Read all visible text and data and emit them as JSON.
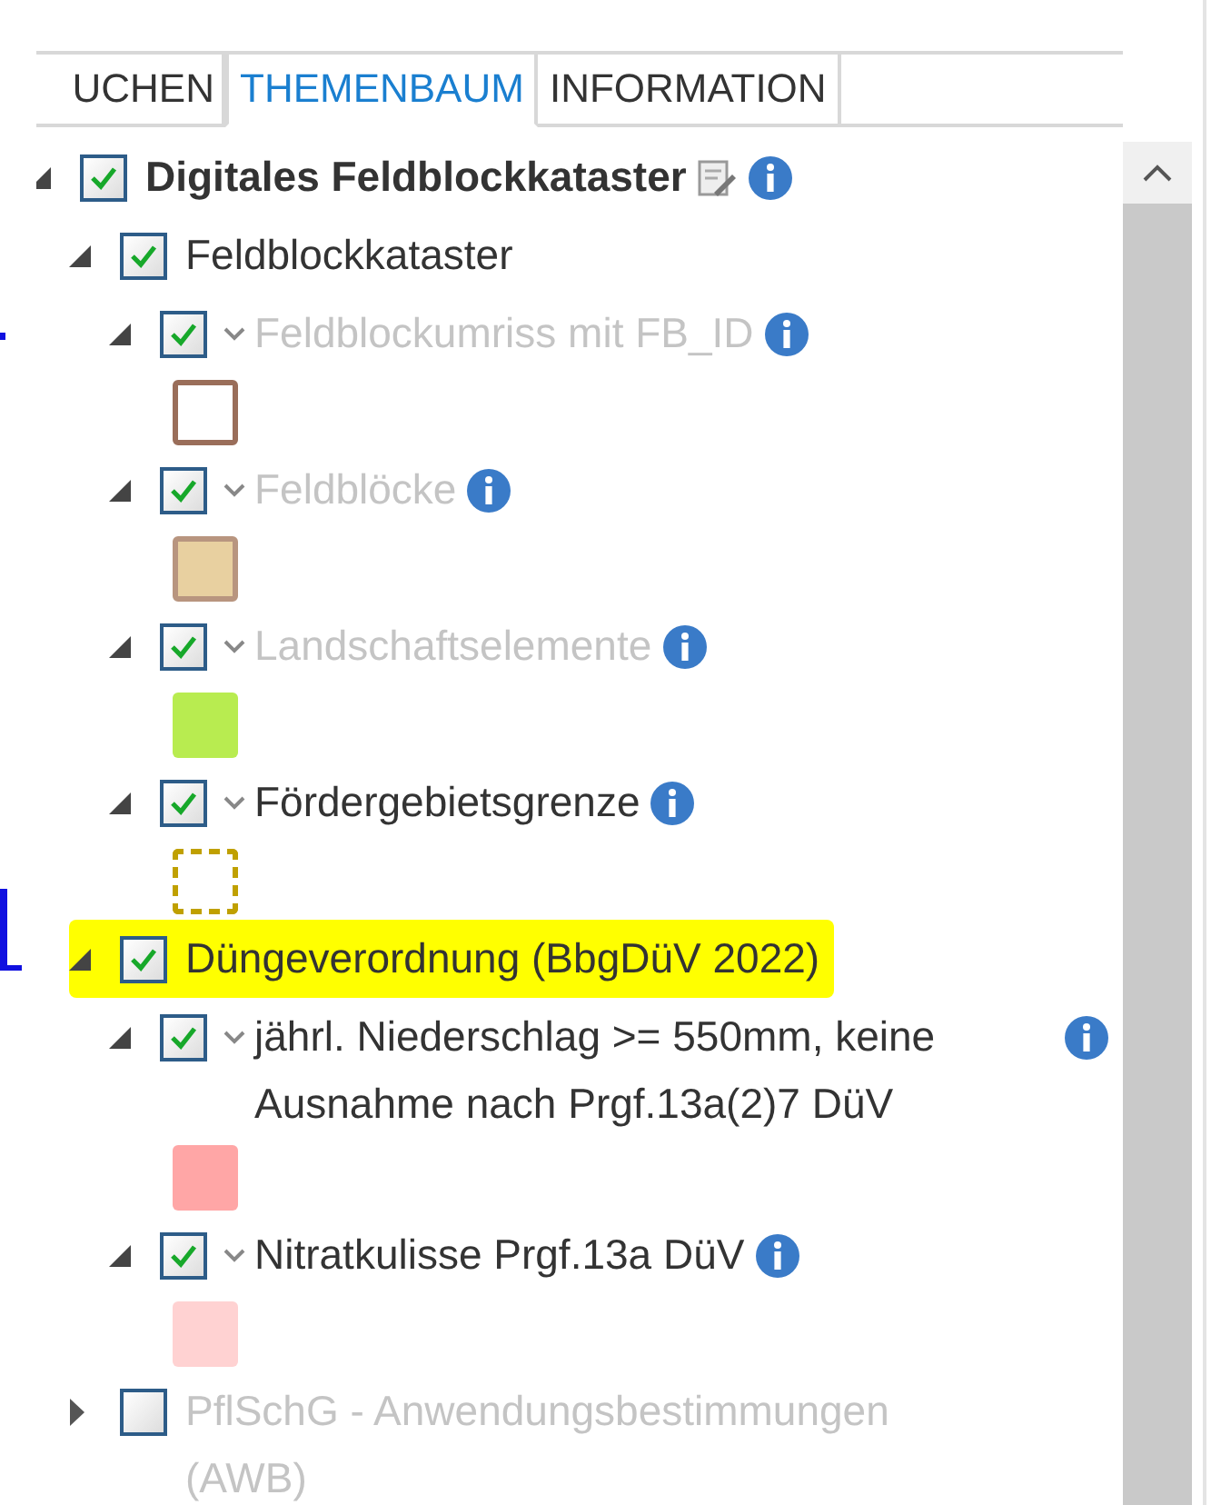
{
  "tabs": [
    {
      "label": "UCHEN",
      "selected": false
    },
    {
      "label": "THEMENBAUM",
      "selected": true
    },
    {
      "label": "INFORMATION",
      "selected": false
    }
  ],
  "tree": [
    {
      "label": "Digitales Feldblockkataster",
      "kind": "root",
      "checked": true,
      "expanded": true,
      "edit_icon": true,
      "info": true,
      "children": [
        {
          "label": "Feldblockkataster",
          "kind": "group",
          "checked": true,
          "expanded": true,
          "children": [
            {
              "label": "Feldblockumriss mit FB_ID",
              "kind": "layer",
              "checked": true,
              "expanded": true,
              "disabled": true,
              "info": true,
              "legend": {
                "kind": "outline",
                "color": "#9a6e5a"
              }
            },
            {
              "label": "Feldblöcke",
              "kind": "layer",
              "checked": true,
              "expanded": true,
              "disabled": true,
              "info": true,
              "legend": {
                "kind": "fill_outline",
                "color": "#e8d0a0"
              }
            },
            {
              "label": "Landschaftselemente",
              "kind": "layer",
              "checked": true,
              "expanded": true,
              "disabled": true,
              "info": true,
              "legend": {
                "kind": "fill",
                "color": "#b8ec50"
              }
            },
            {
              "label": "Fördergebietsgrenze",
              "kind": "layer",
              "checked": true,
              "expanded": true,
              "disabled": false,
              "info": true,
              "legend": {
                "kind": "dashed",
                "color": "#c0a000"
              }
            }
          ]
        },
        {
          "label": "Düngeverordnung (BbgDüV 2022)",
          "kind": "group",
          "checked": true,
          "expanded": true,
          "highlighted": true,
          "children": [
            {
              "label": "jährl. Niederschlag >= 550mm, keine Ausnahme nach Prgf.13a(2)7 DüV",
              "kind": "layer",
              "checked": true,
              "expanded": true,
              "disabled": false,
              "info": true,
              "legend": {
                "kind": "fill",
                "color": "#ffa6a6"
              }
            },
            {
              "label": "Nitratkulisse Prgf.13a DüV",
              "kind": "layer",
              "checked": true,
              "expanded": true,
              "disabled": false,
              "info": true,
              "legend": {
                "kind": "fill",
                "color": "#ffd2d2"
              }
            }
          ]
        },
        {
          "label": "PflSchG - Anwendungsbestimmungen (AWB)",
          "kind": "group",
          "checked": false,
          "expanded": false,
          "disabled": true
        }
      ]
    }
  ]
}
